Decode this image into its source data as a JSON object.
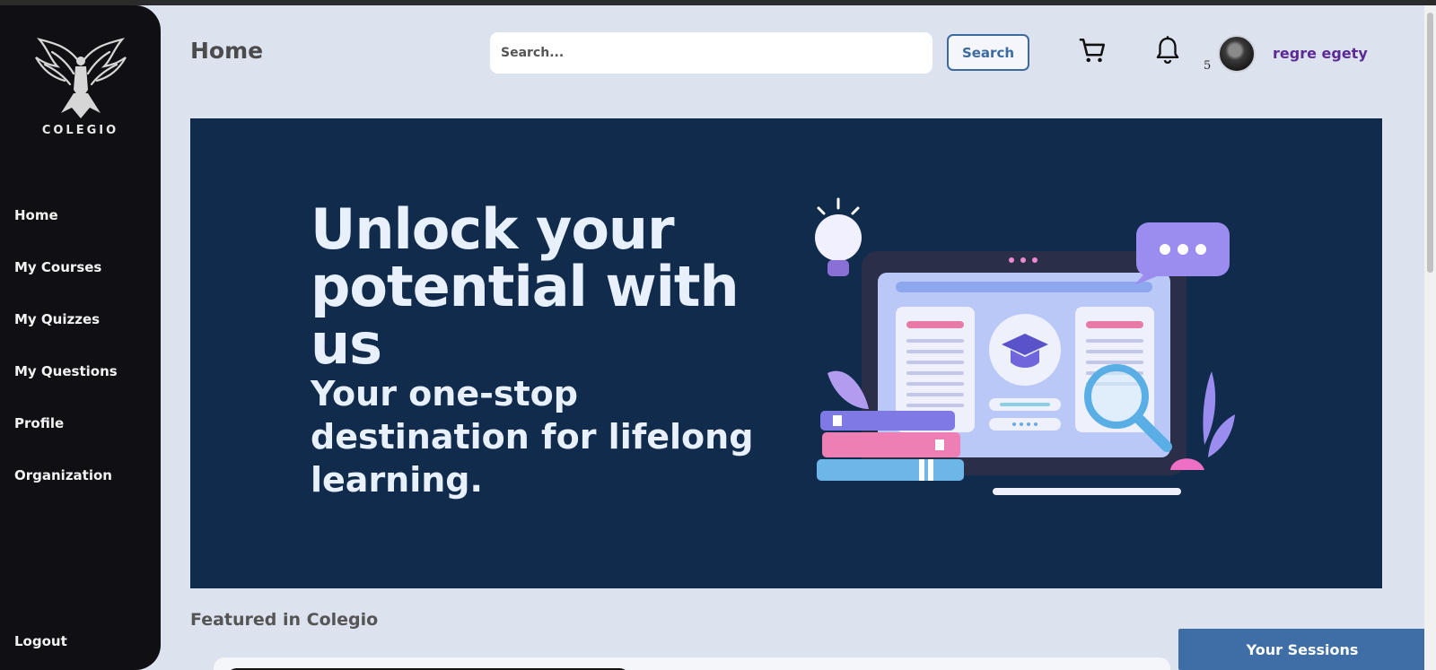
{
  "app": {
    "brand": "COLEGIO",
    "page_title": "Home"
  },
  "sidebar": {
    "items": [
      {
        "label": "Home"
      },
      {
        "label": "My Courses"
      },
      {
        "label": "My Quizzes"
      },
      {
        "label": "My Questions"
      },
      {
        "label": "Profile"
      },
      {
        "label": "Organization"
      }
    ],
    "logout": "Logout"
  },
  "header": {
    "search": {
      "placeholder": "Search...",
      "value": "",
      "button_label": "Search"
    },
    "icons": {
      "cart": "cart-icon",
      "notifications": "bell-icon"
    },
    "notification_count": "5",
    "user": {
      "name": "regre egety"
    }
  },
  "banner": {
    "headline": "Unlock your potential with us",
    "subheadline": "Your one-stop destination for lifelong learning."
  },
  "featured": {
    "title": "Featured in Colegio"
  },
  "sessions_button": "Your Sessions",
  "colors": {
    "sidebar_bg": "#101014",
    "page_bg": "#dce3ef",
    "banner_bg": "#112b4d",
    "accent_blue": "#3f6ea6",
    "username_purple": "#5b2a95"
  }
}
